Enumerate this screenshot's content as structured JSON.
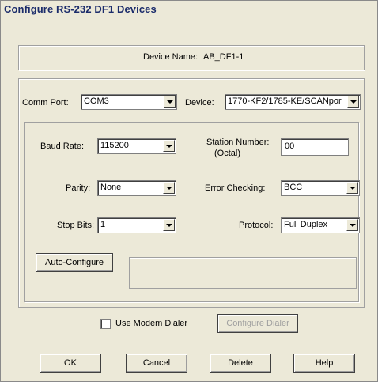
{
  "window": {
    "title": "Configure RS-232 DF1 Devices"
  },
  "device": {
    "name_label": "Device Name:",
    "name_value": "AB_DF1-1"
  },
  "comm_port": {
    "label": "Comm Port:",
    "value": "COM3"
  },
  "device_type": {
    "label": "Device:",
    "value": "1770-KF2/1785-KE/SCANpor"
  },
  "baud_rate": {
    "label": "Baud Rate:",
    "value": "115200"
  },
  "station_number": {
    "label_line1": "Station Number:",
    "label_line2": "(Octal)",
    "value": "00"
  },
  "parity": {
    "label": "Parity:",
    "value": "None"
  },
  "error_checking": {
    "label": "Error Checking:",
    "value": "BCC"
  },
  "stop_bits": {
    "label": "Stop Bits:",
    "value": "1"
  },
  "protocol": {
    "label": "Protocol:",
    "value": "Full Duplex"
  },
  "auto_configure": {
    "label": "Auto-Configure",
    "status": ""
  },
  "modem": {
    "checkbox_label": "Use Modem Dialer",
    "configure_label": "Configure Dialer"
  },
  "buttons": {
    "ok": "OK",
    "cancel": "Cancel",
    "delete": "Delete",
    "help": "Help"
  }
}
